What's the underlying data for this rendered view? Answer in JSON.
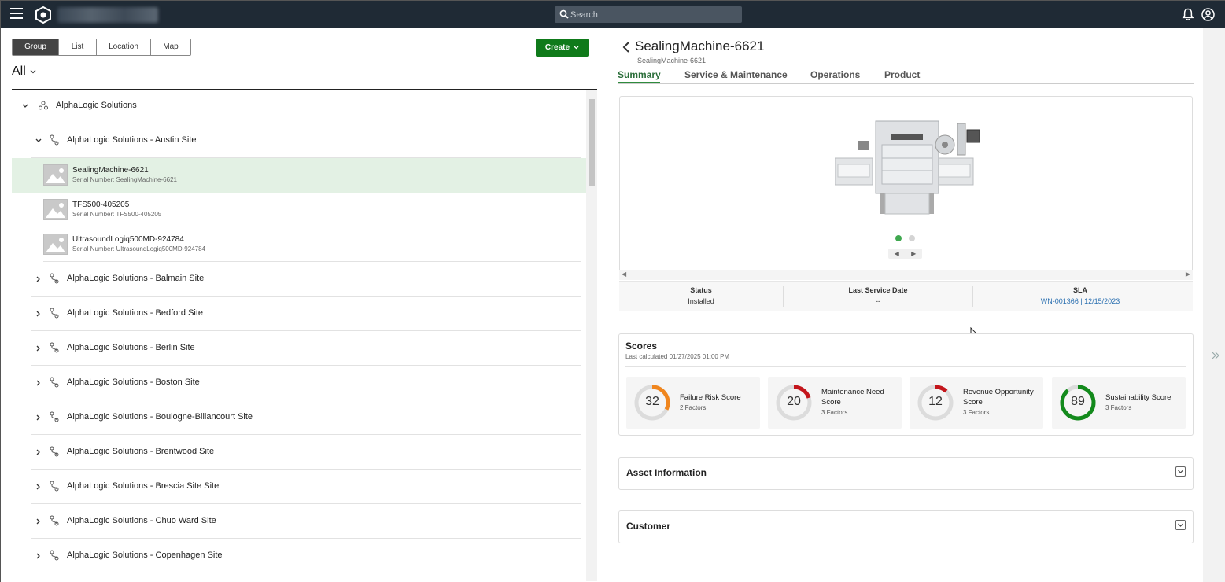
{
  "topbar": {
    "search_placeholder": "Search"
  },
  "left": {
    "view_tabs": [
      "Group",
      "List",
      "Location",
      "Map"
    ],
    "active_tab": "Group",
    "create_label": "Create",
    "filter_label": "All",
    "root": "AlphaLogic Solutions",
    "expanded_site": "AlphaLogic Solutions - Austin Site",
    "assets": [
      {
        "name": "SealingMachine-6621",
        "serial": "Serial Number: SealingMachine-6621",
        "selected": true
      },
      {
        "name": "TFS500-405205",
        "serial": "Serial Number: TFS500-405205",
        "selected": false
      },
      {
        "name": "UltrasoundLogiq500MD-924784",
        "serial": "Serial Number: UltrasoundLogiq500MD-924784",
        "selected": false
      }
    ],
    "sites": [
      "AlphaLogic Solutions - Balmain Site",
      "AlphaLogic Solutions - Bedford Site",
      "AlphaLogic Solutions - Berlin Site",
      "AlphaLogic Solutions - Boston Site",
      "AlphaLogic Solutions - Boulogne-Billancourt Site",
      "AlphaLogic Solutions - Brentwood Site",
      "AlphaLogic Solutions - Brescia Site Site",
      "AlphaLogic Solutions - Chuo Ward Site",
      "AlphaLogic Solutions - Copenhagen Site"
    ]
  },
  "detail": {
    "title": "SealingMachine-6621",
    "subtitle": "SealingMachine-6621",
    "tabs": [
      "Summary",
      "Service & Maintenance",
      "Operations",
      "Product"
    ],
    "active_tab": "Summary",
    "status_label": "Status",
    "status_value": "Installed",
    "last_service_label": "Last Service Date",
    "last_service_value": "--",
    "sla_label": "SLA",
    "sla_value": "WN-001366 | 12/15/2023",
    "scores_title": "Scores",
    "scores_subtitle": "Last calculated 01/27/2025 01:00 PM",
    "scores": [
      {
        "value": "32",
        "percent": 32,
        "name": "Failure Risk Score",
        "factors": "2 Factors",
        "color": "#f0861e"
      },
      {
        "value": "20",
        "percent": 20,
        "name": "Maintenance Need Score",
        "factors": "3 Factors",
        "color": "#c4161c"
      },
      {
        "value": "12",
        "percent": 12,
        "name": "Revenue Opportunity Score",
        "factors": "3 Factors",
        "color": "#c4161c"
      },
      {
        "value": "89",
        "percent": 89,
        "name": "Sustainability Score",
        "factors": "3 Factors",
        "color": "#138a1c"
      }
    ],
    "asset_info_label": "Asset Information",
    "customer_label": "Customer"
  },
  "colors": {
    "topbar": "#1f2a35",
    "accent_green": "#0f7a1a",
    "selected_row": "#e3f1e4",
    "link": "#2a6fb0"
  }
}
